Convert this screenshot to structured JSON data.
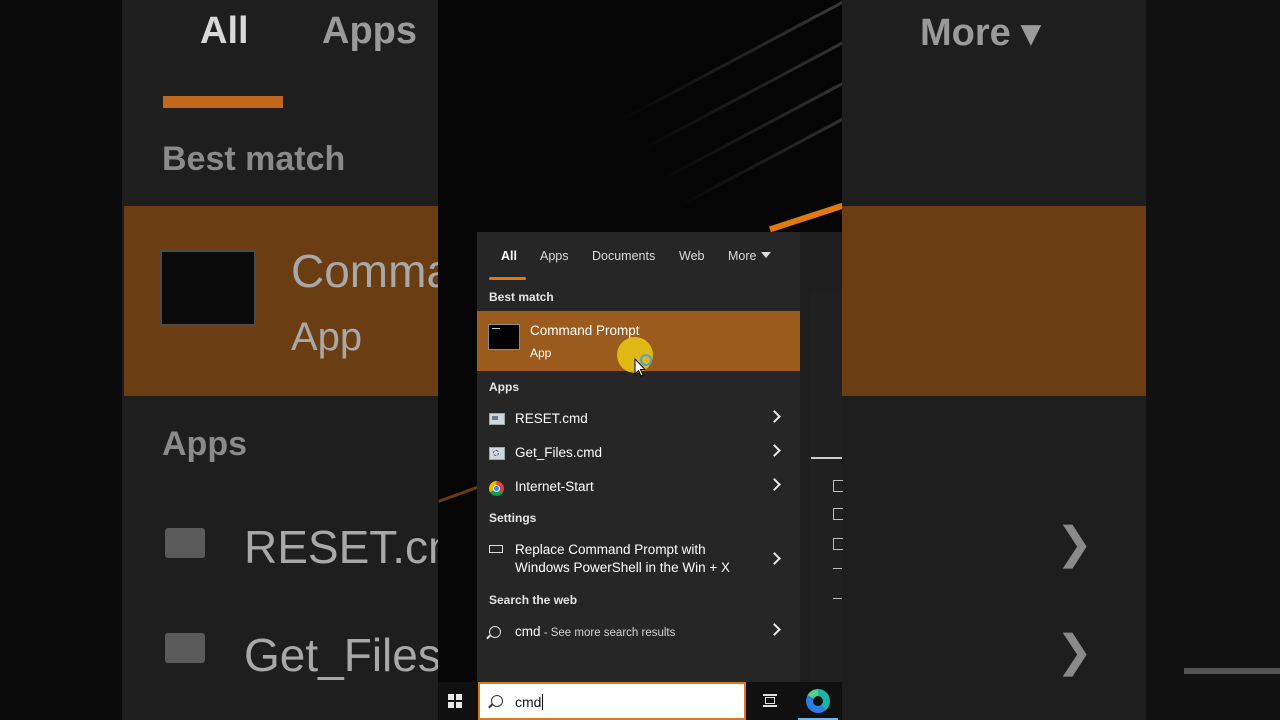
{
  "background": {
    "tabs": {
      "all": "All",
      "apps": "Apps",
      "more": "More ▾"
    },
    "best_match": "Best match",
    "best_title": "Comma",
    "best_sub": "App",
    "apps": "Apps",
    "item1": "RESET.cmd",
    "item2": "Get_Files.c"
  },
  "menu": {
    "tabs": [
      {
        "label": "All"
      },
      {
        "label": "Apps"
      },
      {
        "label": "Documents"
      },
      {
        "label": "Web"
      },
      {
        "label": "More"
      }
    ],
    "best_match_header": "Best match",
    "best_match": {
      "title": "Command Prompt",
      "subtitle": "App",
      "icon": "terminal-icon"
    },
    "apps_header": "Apps",
    "apps": [
      {
        "label": "RESET.cmd",
        "icon": "cmd-file-icon"
      },
      {
        "label": "Get_Files.cmd",
        "icon": "cmd-gear-file-icon"
      },
      {
        "label": "Internet-Start",
        "icon": "chrome-icon"
      }
    ],
    "settings_header": "Settings",
    "settings": [
      {
        "line1": "Replace Command Prompt with",
        "line2": "Windows PowerShell in the Win + X",
        "icon": "keyboard-icon"
      }
    ],
    "web_header": "Search the web",
    "web": {
      "query": "cmd",
      "suffix": " - See more search results",
      "icon": "search-icon"
    }
  },
  "taskbar": {
    "search_value": "cmd",
    "icons": [
      "windows-start-icon",
      "search-icon",
      "task-view-icon",
      "edge-icon"
    ]
  },
  "colors": {
    "accent": "#d9781e",
    "highlight": "#9a5b1d",
    "menu_bg": "#262626"
  }
}
